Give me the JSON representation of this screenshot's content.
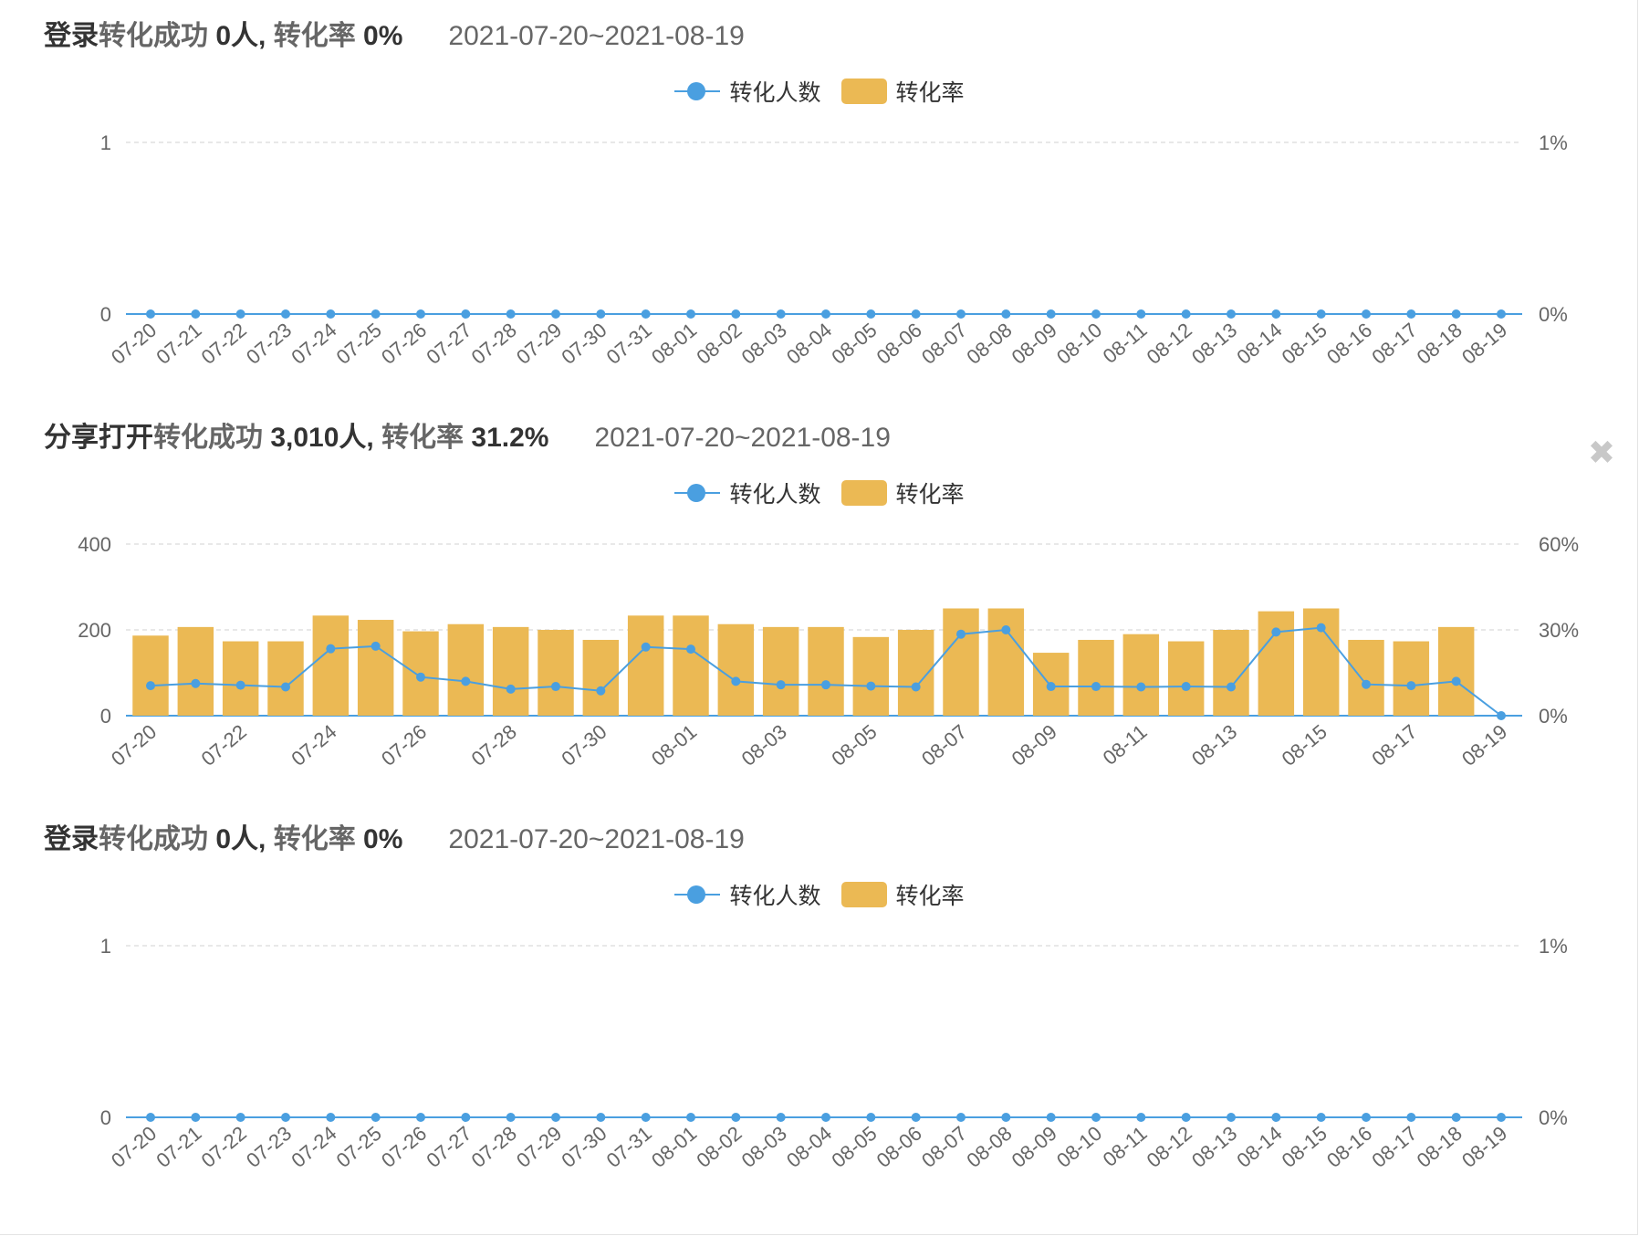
{
  "colors": {
    "line": "#4a9fe0",
    "bar": "#ebb954",
    "grid": "#d9d9d9",
    "axis_text": "#666666"
  },
  "close_icon": "close-icon",
  "panels": [
    {
      "title": {
        "p1": "登录",
        "p2": "转化成功",
        "p3": " 0人, ",
        "p4": "转化率",
        "p5": " 0%",
        "date": "2021-07-20~2021-08-19"
      },
      "legend": {
        "line": "转化人数",
        "bar": "转化率"
      }
    },
    {
      "title": {
        "p1": "分享打开",
        "p2": "转化成功",
        "p3": " 3,010人, ",
        "p4": "转化率",
        "p5": " 31.2%",
        "date": "2021-07-20~2021-08-19"
      },
      "legend": {
        "line": "转化人数",
        "bar": "转化率"
      }
    },
    {
      "title": {
        "p1": "登录",
        "p2": "转化成功",
        "p3": " 0人, ",
        "p4": "转化率",
        "p5": " 0%",
        "date": "2021-07-20~2021-08-19"
      },
      "legend": {
        "line": "转化人数",
        "bar": "转化率"
      }
    }
  ],
  "chart_data": [
    {
      "type": "bar",
      "categories": [
        "07-20",
        "07-21",
        "07-22",
        "07-23",
        "07-24",
        "07-25",
        "07-26",
        "07-27",
        "07-28",
        "07-29",
        "07-30",
        "07-31",
        "08-01",
        "08-02",
        "08-03",
        "08-04",
        "08-05",
        "08-06",
        "08-07",
        "08-08",
        "08-09",
        "08-10",
        "08-11",
        "08-12",
        "08-13",
        "08-14",
        "08-15",
        "08-16",
        "08-17",
        "08-18",
        "08-19"
      ],
      "tick_labels": [
        "07-20",
        "07-21",
        "07-22",
        "07-23",
        "07-24",
        "07-25",
        "07-26",
        "07-27",
        "07-28",
        "07-29",
        "07-30",
        "07-31",
        "08-01",
        "08-02",
        "08-03",
        "08-04",
        "08-05",
        "08-06",
        "08-07",
        "08-08",
        "08-09",
        "08-10",
        "08-11",
        "08-12",
        "08-13",
        "08-14",
        "08-15",
        "08-16",
        "08-17",
        "08-18",
        "08-19"
      ],
      "series": [
        {
          "name": "转化人数",
          "type": "line",
          "axis": "left",
          "values": [
            0,
            0,
            0,
            0,
            0,
            0,
            0,
            0,
            0,
            0,
            0,
            0,
            0,
            0,
            0,
            0,
            0,
            0,
            0,
            0,
            0,
            0,
            0,
            0,
            0,
            0,
            0,
            0,
            0,
            0,
            0
          ]
        },
        {
          "name": "转化率",
          "type": "bar",
          "axis": "right",
          "values": [
            0,
            0,
            0,
            0,
            0,
            0,
            0,
            0,
            0,
            0,
            0,
            0,
            0,
            0,
            0,
            0,
            0,
            0,
            0,
            0,
            0,
            0,
            0,
            0,
            0,
            0,
            0,
            0,
            0,
            0,
            0
          ]
        }
      ],
      "y_left": {
        "range": [
          0,
          1
        ],
        "ticks": [
          "1",
          "0"
        ]
      },
      "y_right": {
        "range": [
          0,
          1
        ],
        "ticks": [
          "1%",
          "0%"
        ]
      },
      "grid": true,
      "legend_position": "top-center"
    },
    {
      "type": "bar",
      "categories": [
        "07-20",
        "07-21",
        "07-22",
        "07-23",
        "07-24",
        "07-25",
        "07-26",
        "07-27",
        "07-28",
        "07-29",
        "07-30",
        "07-31",
        "08-01",
        "08-02",
        "08-03",
        "08-04",
        "08-05",
        "08-06",
        "08-07",
        "08-08",
        "08-09",
        "08-10",
        "08-11",
        "08-12",
        "08-13",
        "08-14",
        "08-15",
        "08-16",
        "08-17",
        "08-18",
        "08-19"
      ],
      "tick_labels": [
        "07-20",
        "",
        "07-22",
        "",
        "07-24",
        "",
        "07-26",
        "",
        "07-28",
        "",
        "07-30",
        "",
        "08-01",
        "",
        "08-03",
        "",
        "08-05",
        "",
        "08-07",
        "",
        "08-09",
        "",
        "08-11",
        "",
        "08-13",
        "",
        "08-15",
        "",
        "08-17",
        "",
        "08-19"
      ],
      "series": [
        {
          "name": "转化人数",
          "type": "line",
          "axis": "left",
          "values": [
            70,
            75,
            71,
            67,
            156,
            162,
            90,
            80,
            62,
            68,
            58,
            160,
            155,
            80,
            72,
            72,
            69,
            67,
            190,
            200,
            68,
            68,
            67,
            68,
            67,
            195,
            205,
            73,
            70,
            80,
            0
          ]
        },
        {
          "name": "转化率",
          "type": "bar",
          "axis": "right",
          "values": [
            28,
            31,
            26,
            26,
            35,
            33.5,
            29.5,
            32,
            31,
            30,
            26.5,
            35,
            35,
            32,
            31,
            31,
            27.5,
            30,
            37.5,
            37.5,
            22,
            26.5,
            28.5,
            26,
            30,
            36.5,
            37.5,
            26.5,
            26,
            31,
            0
          ]
        }
      ],
      "y_left": {
        "range": [
          0,
          400
        ],
        "ticks": [
          "400",
          "200",
          "0"
        ]
      },
      "y_right": {
        "range": [
          0,
          60
        ],
        "ticks": [
          "60%",
          "30%",
          "0%"
        ]
      },
      "grid": true,
      "legend_position": "top-center"
    },
    {
      "type": "bar",
      "categories": [
        "07-20",
        "07-21",
        "07-22",
        "07-23",
        "07-24",
        "07-25",
        "07-26",
        "07-27",
        "07-28",
        "07-29",
        "07-30",
        "07-31",
        "08-01",
        "08-02",
        "08-03",
        "08-04",
        "08-05",
        "08-06",
        "08-07",
        "08-08",
        "08-09",
        "08-10",
        "08-11",
        "08-12",
        "08-13",
        "08-14",
        "08-15",
        "08-16",
        "08-17",
        "08-18",
        "08-19"
      ],
      "tick_labels": [
        "07-20",
        "07-21",
        "07-22",
        "07-23",
        "07-24",
        "07-25",
        "07-26",
        "07-27",
        "07-28",
        "07-29",
        "07-30",
        "07-31",
        "08-01",
        "08-02",
        "08-03",
        "08-04",
        "08-05",
        "08-06",
        "08-07",
        "08-08",
        "08-09",
        "08-10",
        "08-11",
        "08-12",
        "08-13",
        "08-14",
        "08-15",
        "08-16",
        "08-17",
        "08-18",
        "08-19"
      ],
      "series": [
        {
          "name": "转化人数",
          "type": "line",
          "axis": "left",
          "values": [
            0,
            0,
            0,
            0,
            0,
            0,
            0,
            0,
            0,
            0,
            0,
            0,
            0,
            0,
            0,
            0,
            0,
            0,
            0,
            0,
            0,
            0,
            0,
            0,
            0,
            0,
            0,
            0,
            0,
            0,
            0
          ]
        },
        {
          "name": "转化率",
          "type": "bar",
          "axis": "right",
          "values": [
            0,
            0,
            0,
            0,
            0,
            0,
            0,
            0,
            0,
            0,
            0,
            0,
            0,
            0,
            0,
            0,
            0,
            0,
            0,
            0,
            0,
            0,
            0,
            0,
            0,
            0,
            0,
            0,
            0,
            0,
            0
          ]
        }
      ],
      "y_left": {
        "range": [
          0,
          1
        ],
        "ticks": [
          "1",
          "0"
        ]
      },
      "y_right": {
        "range": [
          0,
          1
        ],
        "ticks": [
          "1%",
          "0%"
        ]
      },
      "grid": true,
      "legend_position": "top-center"
    }
  ]
}
